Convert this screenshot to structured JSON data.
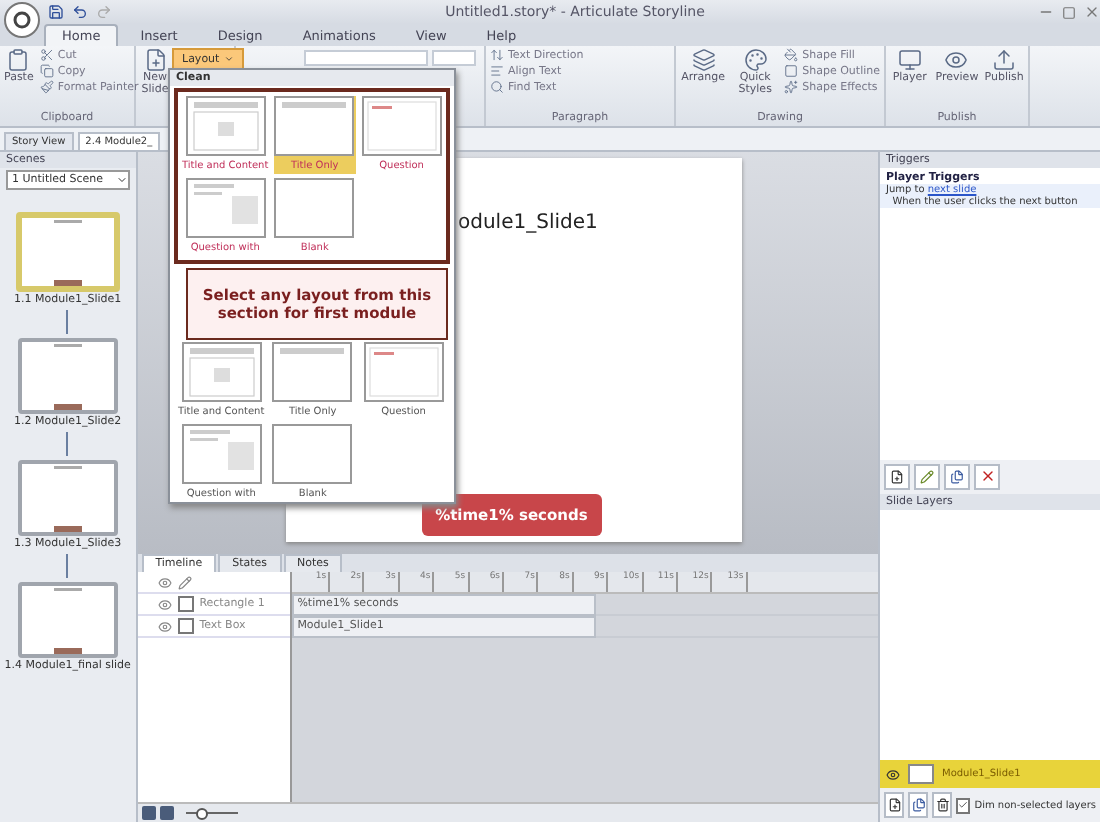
{
  "window": {
    "title": "Untitled1.story* - Articulate Storyline"
  },
  "ribbon_tabs": [
    {
      "label": "Home",
      "selected": true
    },
    {
      "label": "Insert",
      "selected": false
    },
    {
      "label": "Design",
      "selected": false
    },
    {
      "label": "Animations",
      "selected": false
    },
    {
      "label": "View",
      "selected": false
    },
    {
      "label": "Help",
      "selected": false
    }
  ],
  "ribbon_groups": [
    {
      "label": "Clipboard",
      "commands": [
        {
          "label": "Paste",
          "kind": "large"
        },
        {
          "label": "Cut",
          "kind": "small"
        },
        {
          "label": "Copy",
          "kind": "small"
        },
        {
          "label": "Format Painter",
          "kind": "small"
        }
      ]
    },
    {
      "commands": [
        {
          "label": "New Slide",
          "kind": "large"
        }
      ]
    },
    {
      "commands": [
        {
          "kind": "fields"
        }
      ]
    },
    {
      "label": "Paragraph",
      "commands": [
        {
          "label": "Text Direction",
          "kind": "small"
        },
        {
          "label": "Align Text",
          "kind": "small"
        },
        {
          "label": "Find Text",
          "kind": "small"
        }
      ]
    },
    {
      "label": "Drawing",
      "commands": [
        {
          "label": "Arrange",
          "kind": "large"
        },
        {
          "label": "Quick Styles",
          "kind": "large"
        },
        {
          "label": "Shape Fill",
          "kind": "small"
        },
        {
          "label": "Shape Outline",
          "kind": "small"
        },
        {
          "label": "Shape Effects",
          "kind": "small"
        }
      ]
    },
    {
      "label": "Publish",
      "commands": [
        {
          "label": "Player",
          "kind": "large"
        },
        {
          "label": "Preview",
          "kind": "large"
        },
        {
          "label": "Publish",
          "kind": "large"
        }
      ]
    }
  ],
  "document_tabs": [
    {
      "label": "Story View",
      "selected": false
    },
    {
      "label": "2.4 Module2_",
      "selected": true
    }
  ],
  "scenes": {
    "title": "Scenes",
    "scene": "1 Untitled Scene",
    "slides": [
      {
        "label": "1.1 Module1_Slide1",
        "selected": true
      },
      {
        "label": "1.2 Module1_Slide2",
        "selected": false
      },
      {
        "label": "1.3 Module1_Slide3",
        "selected": false
      },
      {
        "label": "1.4 Module1_final slide",
        "selected": false
      }
    ]
  },
  "stage": {
    "slide_title": "odule1_Slide1",
    "timer_button": "%time1% seconds"
  },
  "layout_menu": {
    "button": "Layout",
    "section": "Clean",
    "highlighted_layouts": [
      {
        "label": "Title and Content",
        "kind": "title_content",
        "selected": false
      },
      {
        "label": "Title Only",
        "kind": "title_only",
        "selected": true
      },
      {
        "label": "Question",
        "kind": "question",
        "selected": false
      },
      {
        "label": "Question with",
        "kind": "question_with",
        "selected": false
      },
      {
        "label": "Blank",
        "kind": "blank",
        "selected": false
      }
    ],
    "layouts": [
      {
        "label": "Title and Content",
        "kind": "title_content",
        "selected": false
      },
      {
        "label": "Title Only",
        "kind": "title_only",
        "selected": false
      },
      {
        "label": "Question",
        "kind": "question",
        "selected": false
      },
      {
        "label": "Question with",
        "kind": "question_with",
        "selected": false
      },
      {
        "label": "Blank",
        "kind": "blank",
        "selected": false
      }
    ],
    "callout": "Select any layout from this section for first module"
  },
  "timeline": {
    "tabs": [
      {
        "label": "Timeline",
        "selected": true
      },
      {
        "label": "States",
        "selected": false
      },
      {
        "label": "Notes",
        "selected": false
      }
    ],
    "ticks": [
      "1s",
      "2s",
      "3s",
      "4s",
      "5s",
      "6s",
      "7s",
      "8s",
      "9s",
      "10s",
      "11s",
      "12s",
      "13s"
    ],
    "objects": [
      {
        "name": "Rectangle 1",
        "bar": "%time1% seconds",
        "locked": false
      },
      {
        "name": "Text Box",
        "bar": "Module1_Slide1",
        "locked": false
      }
    ],
    "zoom": {
      "level": 0.3
    }
  },
  "triggers": {
    "title": "Triggers",
    "group": "Player Triggers",
    "action": "Jump to",
    "target": "next slide",
    "condition": "When the user clicks the next button"
  },
  "slide_layers": {
    "title": "Slide Layers",
    "layers": [
      {
        "name": "Module1_Slide1",
        "selected": true
      }
    ],
    "dim": {
      "label": "Dim non-selected layers",
      "checked": true
    }
  }
}
